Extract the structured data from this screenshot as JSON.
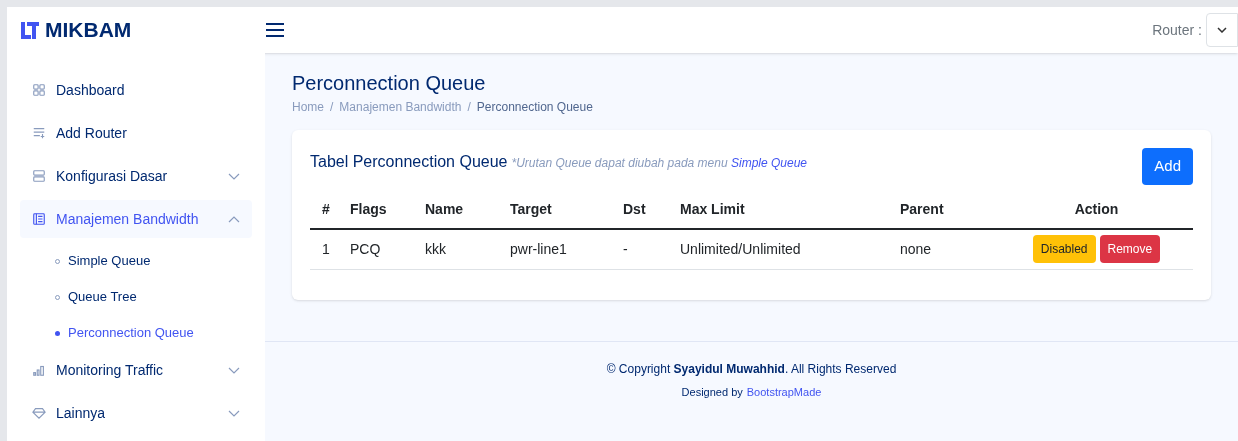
{
  "header": {
    "brand": "MIKBAM",
    "router_label": "Router :"
  },
  "sidebar": {
    "items": [
      {
        "label": "Dashboard",
        "kind": "link",
        "selected": false
      },
      {
        "label": "Add Router",
        "kind": "link",
        "selected": false
      },
      {
        "label": "Konfigurasi Dasar",
        "kind": "group",
        "selected": false,
        "expanded": false
      },
      {
        "label": "Manajemen Bandwidth",
        "kind": "group",
        "selected": true,
        "expanded": true,
        "children": [
          {
            "label": "Simple Queue",
            "selected": false
          },
          {
            "label": "Queue Tree",
            "selected": false
          },
          {
            "label": "Perconnection Queue",
            "selected": true
          }
        ]
      },
      {
        "label": "Monitoring Traffic",
        "kind": "group",
        "selected": false,
        "expanded": false
      },
      {
        "label": "Lainnya",
        "kind": "group",
        "selected": false,
        "expanded": false
      }
    ]
  },
  "page": {
    "title": "Perconnection Queue",
    "breadcrumb": [
      "Home",
      "Manajemen Bandwidth",
      "Perconnection Queue"
    ],
    "breadcrumb_separator": "/"
  },
  "card": {
    "title": "Tabel Perconnection Queue",
    "note": "*Urutan Queue dapat diubah pada menu",
    "note_link": "Simple Queue",
    "add_button": "Add",
    "table": {
      "columns": [
        "#",
        "Flags",
        "Name",
        "Target",
        "Dst",
        "Max Limit",
        "Parent",
        "Action"
      ],
      "rows": [
        {
          "cells": [
            "1",
            "PCQ",
            "kkk",
            "pwr-line1",
            "-",
            "Unlimited/Unlimited",
            "none"
          ],
          "actions": [
            {
              "label": "Disabled",
              "kind": "warning"
            },
            {
              "label": "Remove",
              "kind": "danger"
            }
          ]
        }
      ]
    }
  },
  "footer": {
    "copyright": "© Copyright **Syayidul Muwahhid**. All Rights Reserved",
    "designed_by": "Designed by",
    "designed_link": "BootstrapMade"
  }
}
